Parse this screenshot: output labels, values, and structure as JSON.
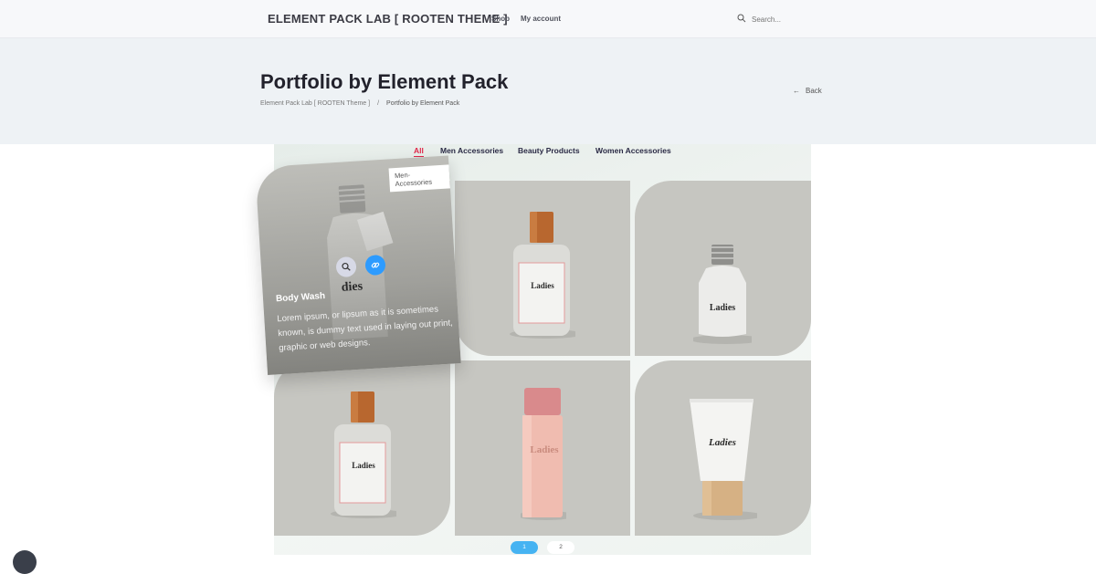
{
  "header": {
    "site_title": "ELEMENT PACK LAB [ ROOTEN THEME ]",
    "nav": [
      "Shop",
      "My account"
    ],
    "search_placeholder": "Search..."
  },
  "page": {
    "title": "Portfolio by Element Pack",
    "breadcrumb": [
      "Element Pack Lab [ ROOTEN Theme ]",
      "/",
      "Portfolio by Element Pack"
    ],
    "back_label": "Back"
  },
  "portfolio": {
    "filters": [
      "All",
      "Men Accessories",
      "Beauty Products",
      "Women Accessories"
    ],
    "active_filter": "All",
    "hover_item": {
      "badge": "Men-Accessories",
      "title": "Body Wash",
      "description": "Lorem ipsum, or lipsum as it is sometimes known, is dummy text used in laying out print, graphic or web designs."
    },
    "product_labels": {
      "brand": "Ladies",
      "hover_bottle": "dies"
    },
    "pagination": [
      "1",
      "2"
    ]
  },
  "colors": {
    "accent_active": "#e0284a",
    "link_icon_bg": "#2d9bff",
    "page_active": "#46b3f2",
    "card_bg": "#c6c6c1"
  }
}
